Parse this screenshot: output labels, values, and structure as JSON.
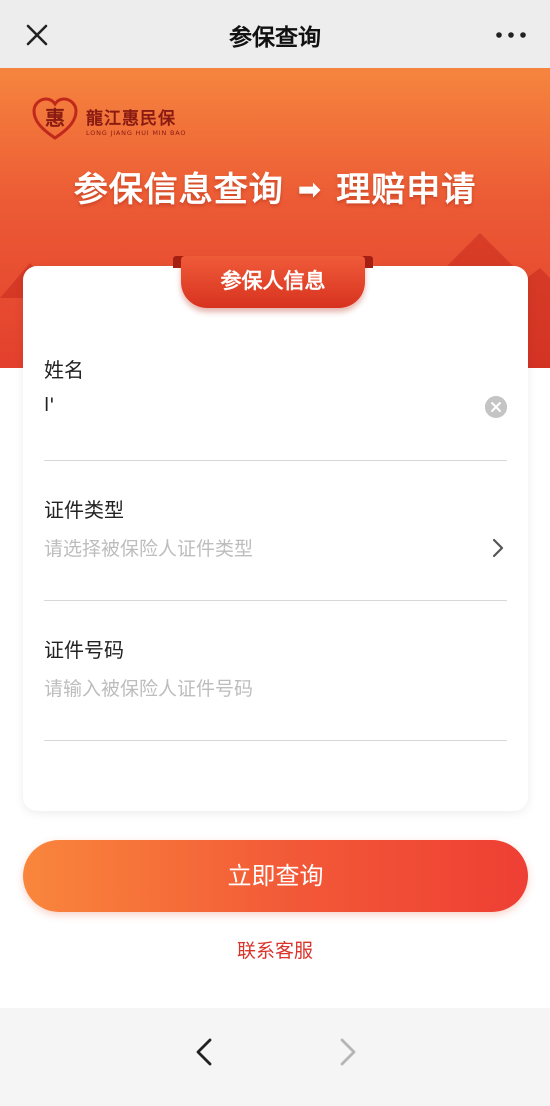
{
  "nav": {
    "title": "参保查询",
    "close_icon": "close-icon",
    "more_icon": "more-icon"
  },
  "banner": {
    "logo_cn": "龍江惠民保",
    "logo_en": "LONG JIANG HUI MIN BAO",
    "logo_mark": "惠",
    "headline_left": "参保信息查询",
    "headline_arrow": "➡",
    "headline_right": "理赔申请"
  },
  "form": {
    "section_title": "参保人信息",
    "name": {
      "label": "姓名",
      "value": "l'"
    },
    "id_type": {
      "label": "证件类型",
      "placeholder": "请选择被保险人证件类型"
    },
    "id_number": {
      "label": "证件号码",
      "placeholder": "请输入被保险人证件号码"
    }
  },
  "actions": {
    "submit_label": "立即查询",
    "contact_label": "联系客服"
  },
  "colors": {
    "brand_red": "#e3402d",
    "button_orange": "#f9863c",
    "contact_red": "#d9332a"
  }
}
